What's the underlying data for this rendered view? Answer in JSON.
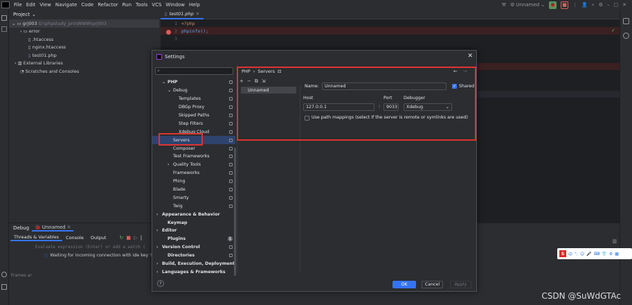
{
  "menubar": {
    "items": [
      "File",
      "Edit",
      "View",
      "Navigate",
      "Code",
      "Refactor",
      "Run",
      "Tools",
      "VCS",
      "Window",
      "Help"
    ]
  },
  "toolbar": {
    "run_config": "Unnamed"
  },
  "project": {
    "header": "Project",
    "root": "grj003",
    "root_path": "D:\\phpstudy_pro\\WWW\\grj003",
    "items": [
      "error",
      ".htaccess",
      "nginx.htaccess",
      "test01.php"
    ],
    "ext_libs": "External Libraries",
    "scratches": "Scratches and Consoles"
  },
  "editor": {
    "tab": "test01.php",
    "lines": [
      {
        "n": "1",
        "code": "<?php"
      },
      {
        "n": "2",
        "code": "phpinfo();"
      },
      {
        "n": "3",
        "code": ""
      }
    ]
  },
  "debug": {
    "title": "Debug",
    "config": "Unnamed",
    "tabs": [
      "Threads & Variables",
      "Console",
      "Output"
    ],
    "eval_placeholder": "Evaluate expression (Enter) or add a watch (",
    "waiting": "Waiting for incoming connection with ide key 'PH",
    "frames": "Frames ar"
  },
  "dialog": {
    "title": "Settings",
    "breadcrumb_parent": "PHP",
    "breadcrumb_child": "Servers",
    "tree": [
      {
        "label": "PHP",
        "indent": 1,
        "arrow": "v",
        "bold": true,
        "pin": true
      },
      {
        "label": "Debug",
        "indent": 2,
        "arrow": "v",
        "pin": true
      },
      {
        "label": "Templates",
        "indent": 3,
        "pin": true
      },
      {
        "label": "DBGp Proxy",
        "indent": 3,
        "pin": true
      },
      {
        "label": "Skipped Paths",
        "indent": 3,
        "pin": true
      },
      {
        "label": "Step Filters",
        "indent": 3,
        "pin": true
      },
      {
        "label": "Xdebug Cloud",
        "indent": 3,
        "pin": true
      },
      {
        "label": "Servers",
        "indent": 2,
        "pin": true,
        "selected": true
      },
      {
        "label": "Composer",
        "indent": 2,
        "pin": true
      },
      {
        "label": "Test Frameworks",
        "indent": 2,
        "pin": true
      },
      {
        "label": "Quality Tools",
        "indent": 2,
        "arrow": ">",
        "pin": true
      },
      {
        "label": "Frameworks",
        "indent": 2,
        "pin": true
      },
      {
        "label": "Phing",
        "indent": 2,
        "pin": true
      },
      {
        "label": "Blade",
        "indent": 2,
        "pin": true
      },
      {
        "label": "Smarty",
        "indent": 2,
        "pin": true
      },
      {
        "label": "Twig",
        "indent": 2,
        "pin": true
      },
      {
        "label": "Appearance & Behavior",
        "indent": 0,
        "arrow": ">",
        "bold": true
      },
      {
        "label": "Keymap",
        "indent": 1,
        "bold": true
      },
      {
        "label": "Editor",
        "indent": 0,
        "arrow": ">",
        "bold": true
      },
      {
        "label": "Plugins",
        "indent": 1,
        "bold": true,
        "badge": "1"
      },
      {
        "label": "Version Control",
        "indent": 0,
        "arrow": ">",
        "bold": true,
        "pin": true
      },
      {
        "label": "Directories",
        "indent": 1,
        "bold": true,
        "pin": true
      },
      {
        "label": "Build, Execution, Deployment",
        "indent": 0,
        "arrow": ">",
        "bold": true
      },
      {
        "label": "Languages & Frameworks",
        "indent": 0,
        "arrow": ">",
        "bold": true
      }
    ],
    "server_item": "Unnamed",
    "name_label": "Name:",
    "name_value": "Unnamed",
    "shared_label": "Shared",
    "host_label": "Host",
    "host_value": "127.0.0.1",
    "port_label": "Port",
    "port_value": "9033",
    "colon": ":",
    "debugger_label": "Debugger",
    "debugger_value": "Xdebug",
    "path_mappings": "Use path mappings (select if the server is remote or symlinks are used)",
    "ok": "OK",
    "cancel": "Cancel",
    "apply": "Apply",
    "help": "?"
  },
  "ime": {
    "text": "中"
  },
  "watermark": "CSDN @SuWdGTAc"
}
